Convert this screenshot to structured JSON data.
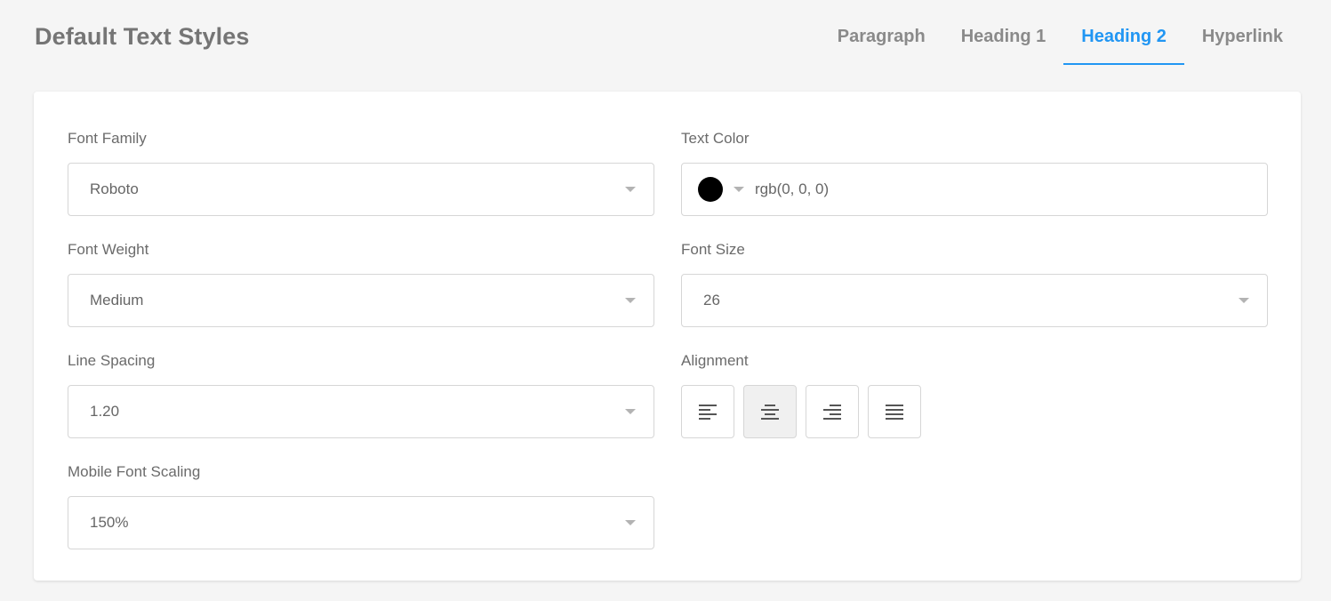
{
  "header": {
    "title": "Default Text Styles"
  },
  "tabs": [
    {
      "label": "Paragraph",
      "active": false
    },
    {
      "label": "Heading 1",
      "active": false
    },
    {
      "label": "Heading 2",
      "active": true
    },
    {
      "label": "Hyperlink",
      "active": false
    }
  ],
  "form": {
    "font_family": {
      "label": "Font Family",
      "value": "Roboto"
    },
    "text_color": {
      "label": "Text Color",
      "value": "rgb(0, 0, 0)",
      "swatch": "#000000"
    },
    "font_weight": {
      "label": "Font Weight",
      "value": "Medium"
    },
    "font_size": {
      "label": "Font Size",
      "value": "26"
    },
    "line_spacing": {
      "label": "Line Spacing",
      "value": "1.20"
    },
    "alignment": {
      "label": "Alignment",
      "selected": "center",
      "options": [
        "left",
        "center",
        "right",
        "justify"
      ]
    },
    "mobile_font_scaling": {
      "label": "Mobile Font Scaling",
      "value": "150%"
    }
  },
  "colors": {
    "accent": "#2196f3",
    "background": "#f5f5f5",
    "card": "#ffffff"
  }
}
